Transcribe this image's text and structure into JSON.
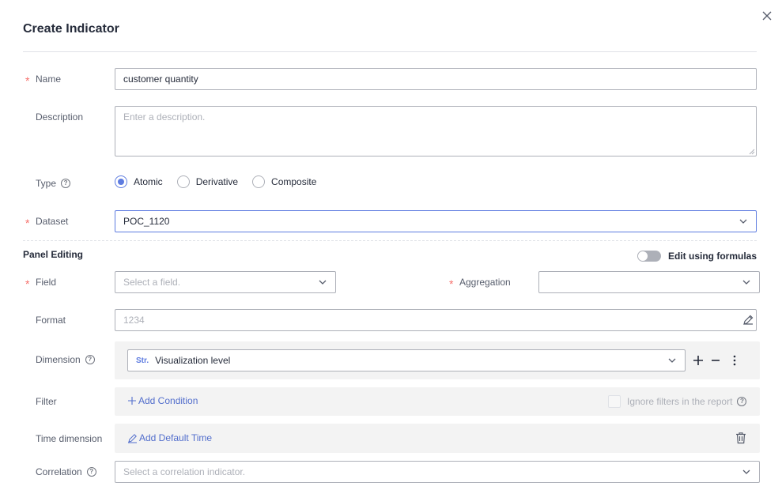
{
  "dialog": {
    "title": "Create Indicator"
  },
  "form": {
    "name": {
      "label": "Name",
      "value": "customer quantity"
    },
    "description": {
      "label": "Description",
      "placeholder": "Enter a description."
    },
    "type": {
      "label": "Type",
      "options": [
        "Atomic",
        "Derivative",
        "Composite"
      ],
      "selected": "Atomic"
    },
    "dataset": {
      "label": "Dataset",
      "value": "POC_1120"
    }
  },
  "panel_editing": {
    "title": "Panel Editing",
    "toggle_label": "Edit using formulas",
    "toggle_on": false,
    "field": {
      "label": "Field",
      "placeholder": "Select a field."
    },
    "aggregation": {
      "label": "Aggregation",
      "value": ""
    },
    "format": {
      "label": "Format",
      "placeholder": "1234"
    },
    "dimension": {
      "label": "Dimension",
      "type_tag": "Str.",
      "value": "Visualization level"
    },
    "filter": {
      "label": "Filter",
      "add_label": "Add Condition",
      "ignore_label": "Ignore filters in the report"
    },
    "time_dimension": {
      "label": "Time dimension",
      "add_label": "Add Default Time"
    },
    "correlation": {
      "label": "Correlation",
      "placeholder": "Select a correlation indicator."
    }
  },
  "colors": {
    "primary": "#5e7ce0",
    "link": "#526ecc",
    "required": "#f66f6a",
    "border": "#adb0b8",
    "panel_bg": "#f3f3f3"
  },
  "icons": {
    "close": "close-icon",
    "chevron": "chevron-down-icon",
    "help": "help-circle-icon",
    "edit": "pencil-icon",
    "add": "plus-icon",
    "remove": "minus-icon",
    "more": "more-vertical-icon",
    "delete": "trash-icon"
  }
}
